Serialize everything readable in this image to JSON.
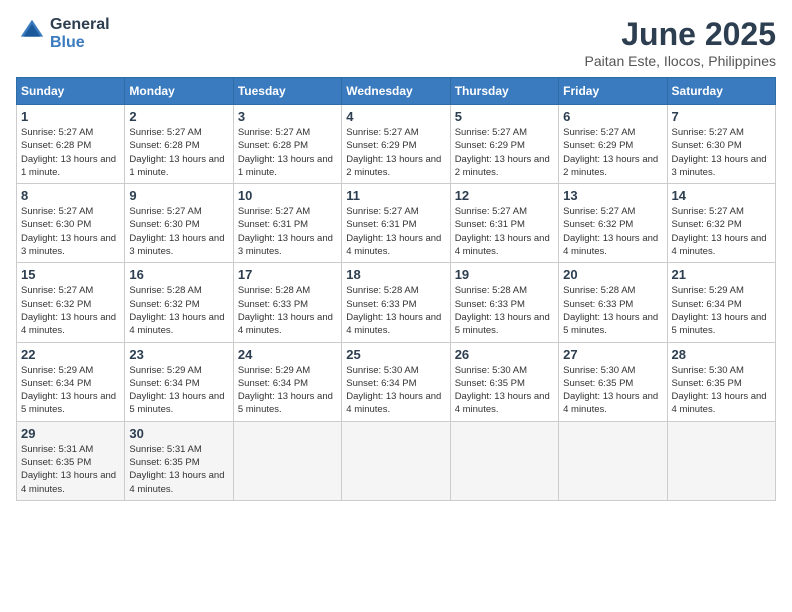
{
  "logo": {
    "line1": "General",
    "line2": "Blue"
  },
  "title": "June 2025",
  "subtitle": "Paitan Este, Ilocos, Philippines",
  "weekdays": [
    "Sunday",
    "Monday",
    "Tuesday",
    "Wednesday",
    "Thursday",
    "Friday",
    "Saturday"
  ],
  "weeks": [
    [
      {
        "day": "1",
        "sunrise": "5:27 AM",
        "sunset": "6:28 PM",
        "daylight": "13 hours and 1 minute."
      },
      {
        "day": "2",
        "sunrise": "5:27 AM",
        "sunset": "6:28 PM",
        "daylight": "13 hours and 1 minute."
      },
      {
        "day": "3",
        "sunrise": "5:27 AM",
        "sunset": "6:28 PM",
        "daylight": "13 hours and 1 minute."
      },
      {
        "day": "4",
        "sunrise": "5:27 AM",
        "sunset": "6:29 PM",
        "daylight": "13 hours and 2 minutes."
      },
      {
        "day": "5",
        "sunrise": "5:27 AM",
        "sunset": "6:29 PM",
        "daylight": "13 hours and 2 minutes."
      },
      {
        "day": "6",
        "sunrise": "5:27 AM",
        "sunset": "6:29 PM",
        "daylight": "13 hours and 2 minutes."
      },
      {
        "day": "7",
        "sunrise": "5:27 AM",
        "sunset": "6:30 PM",
        "daylight": "13 hours and 3 minutes."
      }
    ],
    [
      {
        "day": "8",
        "sunrise": "5:27 AM",
        "sunset": "6:30 PM",
        "daylight": "13 hours and 3 minutes."
      },
      {
        "day": "9",
        "sunrise": "5:27 AM",
        "sunset": "6:30 PM",
        "daylight": "13 hours and 3 minutes."
      },
      {
        "day": "10",
        "sunrise": "5:27 AM",
        "sunset": "6:31 PM",
        "daylight": "13 hours and 3 minutes."
      },
      {
        "day": "11",
        "sunrise": "5:27 AM",
        "sunset": "6:31 PM",
        "daylight": "13 hours and 4 minutes."
      },
      {
        "day": "12",
        "sunrise": "5:27 AM",
        "sunset": "6:31 PM",
        "daylight": "13 hours and 4 minutes."
      },
      {
        "day": "13",
        "sunrise": "5:27 AM",
        "sunset": "6:32 PM",
        "daylight": "13 hours and 4 minutes."
      },
      {
        "day": "14",
        "sunrise": "5:27 AM",
        "sunset": "6:32 PM",
        "daylight": "13 hours and 4 minutes."
      }
    ],
    [
      {
        "day": "15",
        "sunrise": "5:27 AM",
        "sunset": "6:32 PM",
        "daylight": "13 hours and 4 minutes."
      },
      {
        "day": "16",
        "sunrise": "5:28 AM",
        "sunset": "6:32 PM",
        "daylight": "13 hours and 4 minutes."
      },
      {
        "day": "17",
        "sunrise": "5:28 AM",
        "sunset": "6:33 PM",
        "daylight": "13 hours and 4 minutes."
      },
      {
        "day": "18",
        "sunrise": "5:28 AM",
        "sunset": "6:33 PM",
        "daylight": "13 hours and 4 minutes."
      },
      {
        "day": "19",
        "sunrise": "5:28 AM",
        "sunset": "6:33 PM",
        "daylight": "13 hours and 5 minutes."
      },
      {
        "day": "20",
        "sunrise": "5:28 AM",
        "sunset": "6:33 PM",
        "daylight": "13 hours and 5 minutes."
      },
      {
        "day": "21",
        "sunrise": "5:29 AM",
        "sunset": "6:34 PM",
        "daylight": "13 hours and 5 minutes."
      }
    ],
    [
      {
        "day": "22",
        "sunrise": "5:29 AM",
        "sunset": "6:34 PM",
        "daylight": "13 hours and 5 minutes."
      },
      {
        "day": "23",
        "sunrise": "5:29 AM",
        "sunset": "6:34 PM",
        "daylight": "13 hours and 5 minutes."
      },
      {
        "day": "24",
        "sunrise": "5:29 AM",
        "sunset": "6:34 PM",
        "daylight": "13 hours and 5 minutes."
      },
      {
        "day": "25",
        "sunrise": "5:30 AM",
        "sunset": "6:34 PM",
        "daylight": "13 hours and 4 minutes."
      },
      {
        "day": "26",
        "sunrise": "5:30 AM",
        "sunset": "6:35 PM",
        "daylight": "13 hours and 4 minutes."
      },
      {
        "day": "27",
        "sunrise": "5:30 AM",
        "sunset": "6:35 PM",
        "daylight": "13 hours and 4 minutes."
      },
      {
        "day": "28",
        "sunrise": "5:30 AM",
        "sunset": "6:35 PM",
        "daylight": "13 hours and 4 minutes."
      }
    ],
    [
      {
        "day": "29",
        "sunrise": "5:31 AM",
        "sunset": "6:35 PM",
        "daylight": "13 hours and 4 minutes."
      },
      {
        "day": "30",
        "sunrise": "5:31 AM",
        "sunset": "6:35 PM",
        "daylight": "13 hours and 4 minutes."
      },
      null,
      null,
      null,
      null,
      null
    ]
  ]
}
